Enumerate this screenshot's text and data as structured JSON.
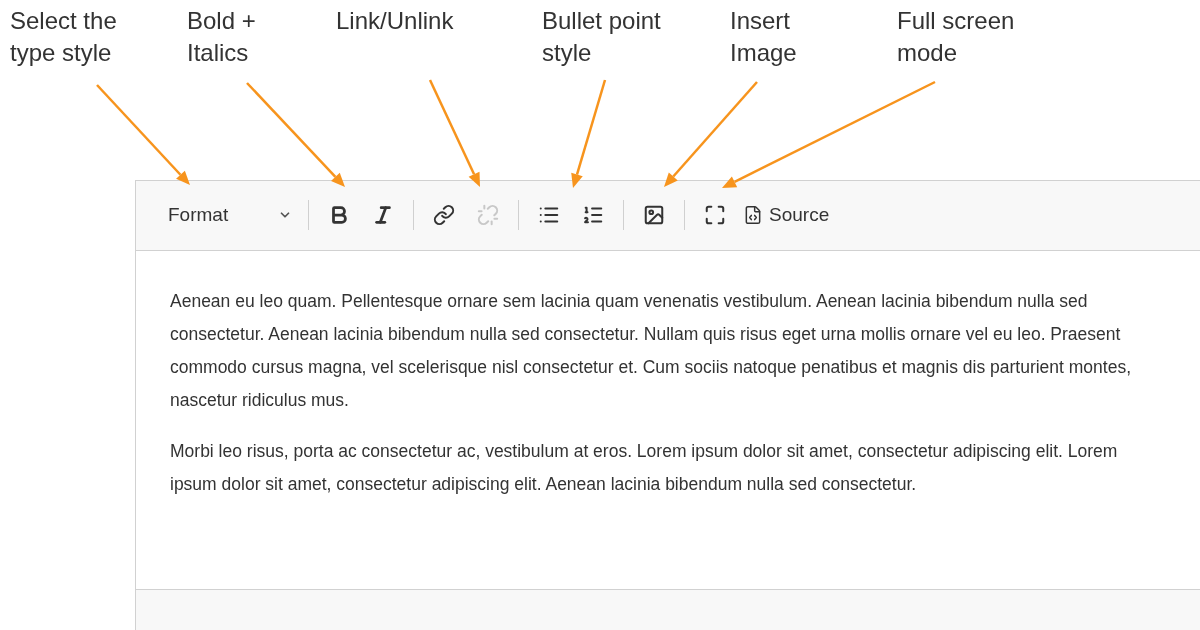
{
  "annotations": [
    {
      "text": "Select the\ntype style"
    },
    {
      "text": "Bold +\nItalics"
    },
    {
      "text": "Link/Unlink"
    },
    {
      "text": "Bullet point\nstyle"
    },
    {
      "text": "Insert\nImage"
    },
    {
      "text": "Full screen\nmode"
    }
  ],
  "toolbar": [
    {
      "kind": "dropdown",
      "label": "Format"
    },
    {
      "kind": "separator"
    },
    {
      "kind": "bold",
      "disabled": false
    },
    {
      "kind": "italic",
      "disabled": false
    },
    {
      "kind": "separator"
    },
    {
      "kind": "link",
      "disabled": false
    },
    {
      "kind": "unlink",
      "disabled": true
    },
    {
      "kind": "separator"
    },
    {
      "kind": "bulleted-list",
      "disabled": false
    },
    {
      "kind": "numbered-list",
      "disabled": false
    },
    {
      "kind": "separator"
    },
    {
      "kind": "image",
      "disabled": false
    },
    {
      "kind": "separator"
    },
    {
      "kind": "maximize",
      "disabled": false
    },
    {
      "kind": "source",
      "label": "Source",
      "disabled": false
    }
  ],
  "content": [
    "Aenean eu leo quam. Pellentesque ornare sem lacinia quam venenatis vestibulum. Aenean lacinia bibendum nulla sed consectetur. Aenean lacinia bibendum nulla sed consectetur. Nullam quis risus eget urna mollis ornare vel eu leo. Praesent commodo cursus magna, vel scelerisque nisl consectetur et. Cum sociis natoque penatibus et magnis dis parturient montes, nascetur ridiculus mus.",
    "Morbi leo risus, porta ac consectetur ac, vestibulum at eros. Lorem ipsum dolor sit amet, consectetur adipiscing elit. Lorem ipsum dolor sit amet, consectetur adipiscing elit. Aenean lacinia bibendum nulla sed consectetur."
  ]
}
